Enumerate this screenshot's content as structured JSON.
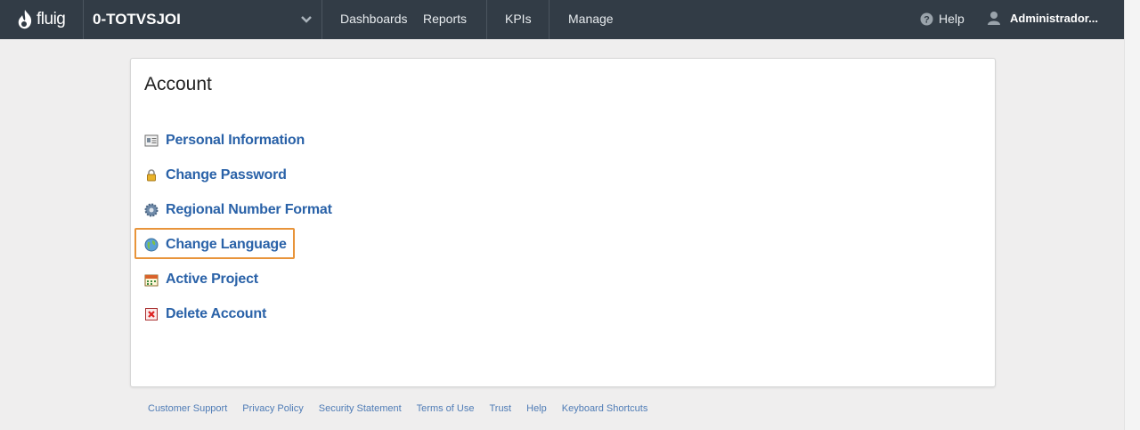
{
  "header": {
    "logo_text": "fluig",
    "project": "0-TOTVSJOI",
    "nav": [
      "Dashboards",
      "Reports",
      "KPIs",
      "Manage"
    ],
    "help_label": "Help",
    "user_label": "Administrador..."
  },
  "account": {
    "title": "Account",
    "items": [
      {
        "label": "Personal Information",
        "icon": "id-card-icon"
      },
      {
        "label": "Change Password",
        "icon": "lock-icon"
      },
      {
        "label": "Regional Number Format",
        "icon": "gear-icon"
      },
      {
        "label": "Change Language",
        "icon": "globe-icon"
      },
      {
        "label": "Active Project",
        "icon": "calendar-icon"
      },
      {
        "label": "Delete Account",
        "icon": "delete-icon"
      }
    ]
  },
  "footer": {
    "links": [
      "Customer Support",
      "Privacy Policy",
      "Security Statement",
      "Terms of Use",
      "Trust",
      "Help",
      "Keyboard Shortcuts"
    ]
  },
  "colors": {
    "topbar": "#323c46",
    "link": "#2a62a8",
    "highlight": "#e8943a"
  }
}
